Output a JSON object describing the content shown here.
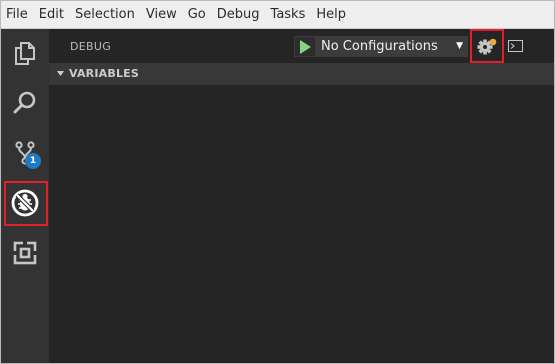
{
  "menu": {
    "items": [
      "File",
      "Edit",
      "Selection",
      "View",
      "Go",
      "Debug",
      "Tasks",
      "Help"
    ]
  },
  "activity_bar": {
    "items": [
      {
        "name": "explorer",
        "icon": "files-icon"
      },
      {
        "name": "search",
        "icon": "search-icon"
      },
      {
        "name": "source-control",
        "icon": "source-control-icon",
        "badge": "1"
      },
      {
        "name": "debug",
        "icon": "debug-icon",
        "active": true
      },
      {
        "name": "extensions",
        "icon": "extensions-icon"
      }
    ]
  },
  "debug_panel": {
    "title": "DEBUG",
    "configuration": "No Configurations",
    "start_icon": "play-icon",
    "settings_icon": "gear-icon",
    "console_icon": "debug-console-icon"
  },
  "variables": {
    "title": "VARIABLES",
    "expanded": true
  },
  "colors": {
    "highlight": "#e0202a",
    "badge": "#1e7bc4",
    "play": "#89d185"
  }
}
